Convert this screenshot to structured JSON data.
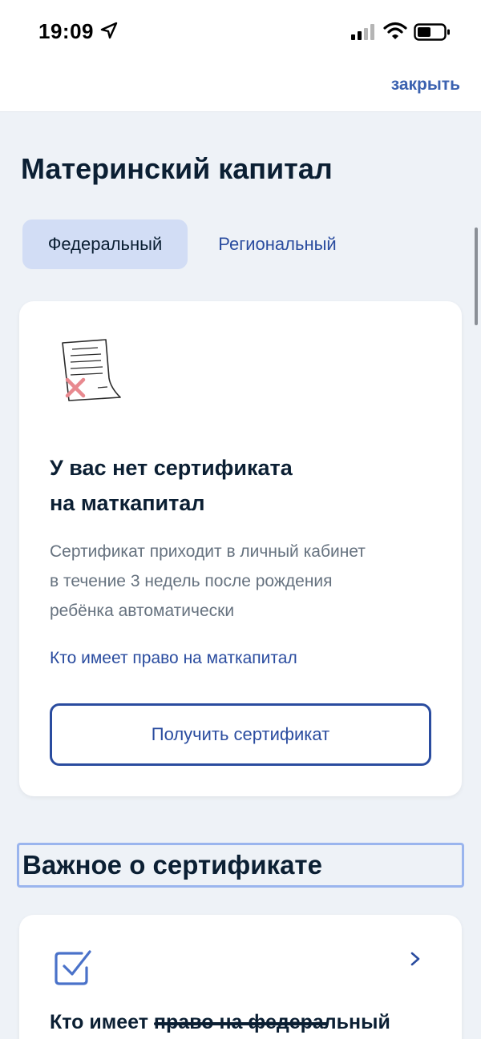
{
  "status": {
    "time": "19:09"
  },
  "header": {
    "close_label": "закрыть"
  },
  "page": {
    "title": "Материнский капитал"
  },
  "tabs": [
    {
      "label": "Федеральный",
      "active": true
    },
    {
      "label": "Региональный",
      "active": false
    }
  ],
  "certificate_card": {
    "heading_line1": "У вас нет сертификата",
    "heading_line2": "на маткапитал",
    "description_line1": "Сертификат приходит в личный кабинет",
    "description_line2": "в течение 3 недель после рождения",
    "description_line3": "ребёнка автоматически",
    "link_label": "Кто имеет право на маткапитал",
    "button_label": "Получить сертификат"
  },
  "important_section": {
    "title": "Важное о сертификате"
  },
  "eligibility_card": {
    "heading": "Кто имеет право на федеральный"
  },
  "colors": {
    "accent": "#2a4c9f",
    "tab_active_bg": "#d2ddf5",
    "background": "#eef2f7"
  },
  "icons": [
    "location-arrow-icon",
    "cellular-signal-icon",
    "wifi-icon",
    "battery-icon",
    "document-rejected-illustration",
    "checkbox-checked-icon",
    "chevron-right-icon"
  ]
}
